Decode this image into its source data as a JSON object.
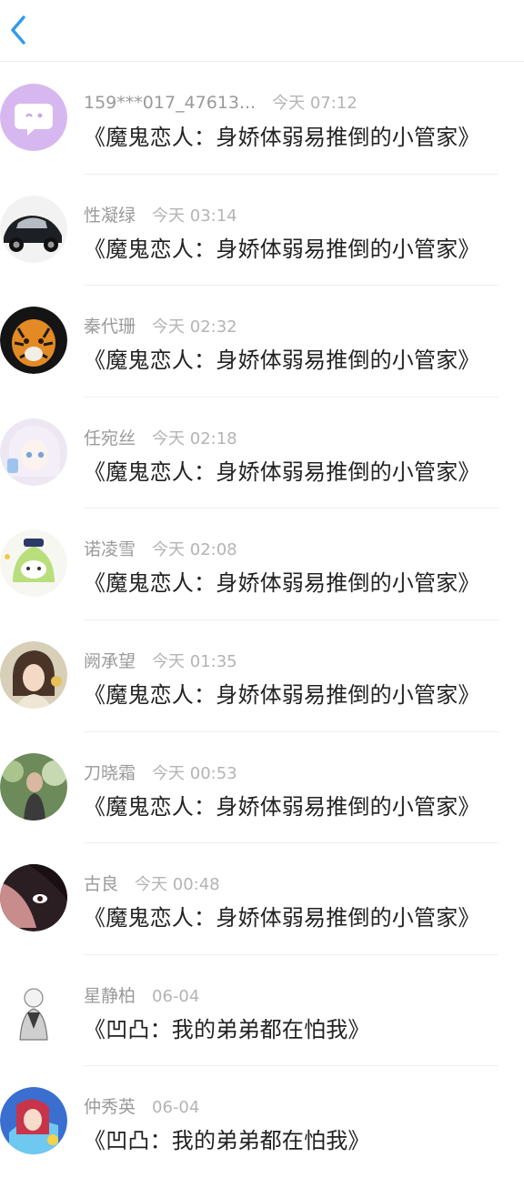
{
  "header": {
    "back_icon": "chevron-left-icon",
    "accent": "#2f9bf0"
  },
  "messages": [
    {
      "name": "159***017_47613...",
      "time": "今天 07:12",
      "text": "《魔鬼恋人：身娇体弱易推倒的小管家》",
      "avatar": "default-chat-bubble"
    },
    {
      "name": "性凝绿",
      "time": "今天 03:14",
      "text": "《魔鬼恋人：身娇体弱易推倒的小管家》",
      "avatar": "car"
    },
    {
      "name": "秦代珊",
      "time": "今天 02:32",
      "text": "《魔鬼恋人：身娇体弱易推倒的小管家》",
      "avatar": "tiger"
    },
    {
      "name": "任宛丝",
      "time": "今天 02:18",
      "text": "《魔鬼恋人：身娇体弱易推倒的小管家》",
      "avatar": "anime-girl"
    },
    {
      "name": "诺凌雪",
      "time": "今天 02:08",
      "text": "《魔鬼恋人：身娇体弱易推倒的小管家》",
      "avatar": "cartoon-zongzi"
    },
    {
      "name": "阙承望",
      "time": "今天 01:35",
      "text": "《魔鬼恋人：身娇体弱易推倒的小管家》",
      "avatar": "woman-photo"
    },
    {
      "name": "刀晓霜",
      "time": "今天 00:53",
      "text": "《魔鬼恋人：身娇体弱易推倒的小管家》",
      "avatar": "man-outdoor"
    },
    {
      "name": "古良",
      "time": "今天 00:48",
      "text": "《魔鬼恋人：身娇体弱易推倒的小管家》",
      "avatar": "anime-dark"
    },
    {
      "name": "星静柏",
      "time": "06-04",
      "text": "《凹凸：我的弟弟都在怕我》",
      "avatar": "sketch-figure"
    },
    {
      "name": "仲秀英",
      "time": "06-04",
      "text": "《凹凸：我的弟弟都在怕我》",
      "avatar": "anime-colorful"
    }
  ]
}
